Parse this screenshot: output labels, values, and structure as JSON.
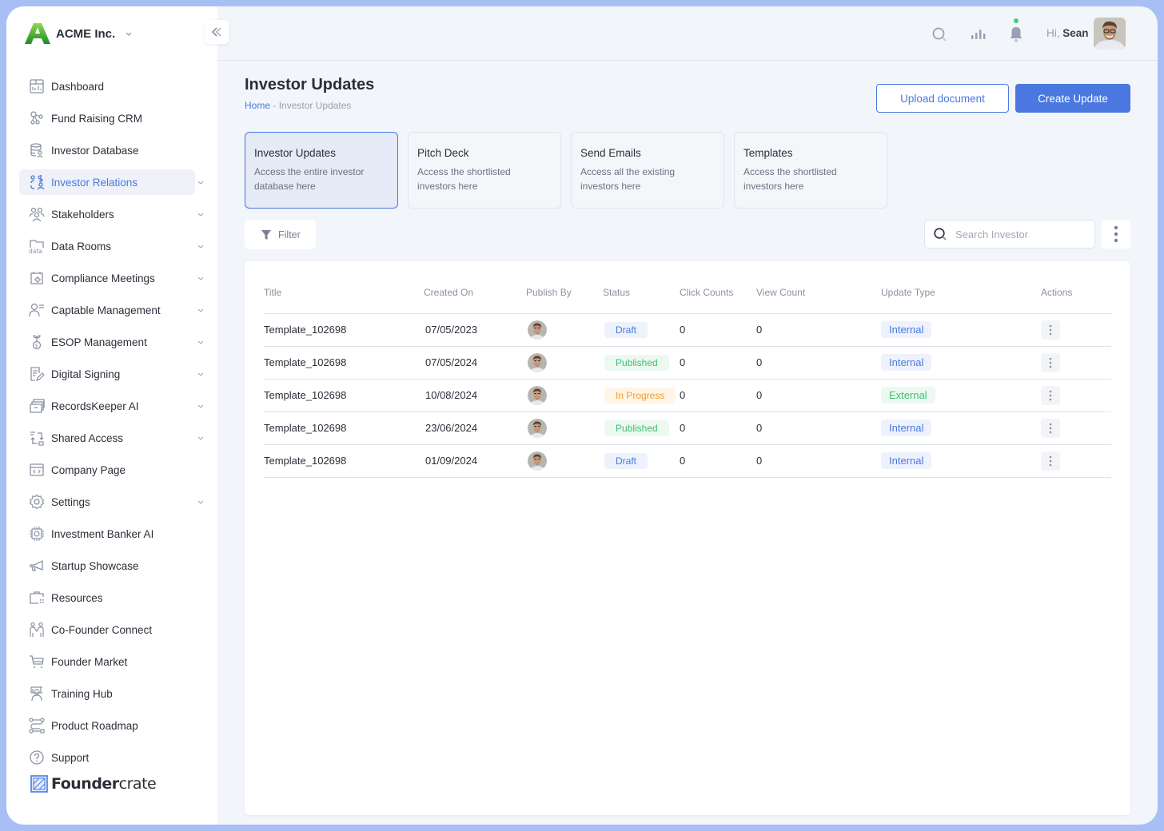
{
  "brand": {
    "name": "ACME Inc."
  },
  "sidebar": {
    "items": [
      {
        "label": "Dashboard",
        "icon": "dashboard-icon",
        "has_children": false,
        "active": false
      },
      {
        "label": "Fund Raising CRM",
        "icon": "crm-icon",
        "has_children": false,
        "active": false
      },
      {
        "label": "Investor Database",
        "icon": "database-user-icon",
        "has_children": false,
        "active": false
      },
      {
        "label": "Investor Relations",
        "icon": "investor-relations-icon",
        "has_children": true,
        "active": true
      },
      {
        "label": "Stakeholders",
        "icon": "users-icon",
        "has_children": true,
        "active": false
      },
      {
        "label": "Data Rooms",
        "icon": "data-folder-icon",
        "has_children": true,
        "active": false
      },
      {
        "label": "Compliance Meetings",
        "icon": "calendar-gear-icon",
        "has_children": true,
        "active": false
      },
      {
        "label": "Captable Management",
        "icon": "user-list-icon",
        "has_children": true,
        "active": false
      },
      {
        "label": "ESOP Management",
        "icon": "plant-coin-icon",
        "has_children": true,
        "active": false
      },
      {
        "label": "Digital Signing",
        "icon": "document-sign-icon",
        "has_children": true,
        "active": false
      },
      {
        "label": "RecordsKeeper AI",
        "icon": "archive-icon",
        "has_children": true,
        "active": false
      },
      {
        "label": "Shared Access",
        "icon": "share-access-icon",
        "has_children": true,
        "active": false
      },
      {
        "label": "Company Page",
        "icon": "browser-code-icon",
        "has_children": false,
        "active": false
      },
      {
        "label": "Settings",
        "icon": "gear-icon",
        "has_children": true,
        "active": false
      },
      {
        "label": "Investment Banker AI",
        "icon": "chip-icon",
        "has_children": false,
        "active": false
      },
      {
        "label": "Startup Showcase",
        "icon": "megaphone-icon",
        "has_children": false,
        "active": false
      },
      {
        "label": "Resources",
        "icon": "briefcase-icon",
        "has_children": false,
        "active": false
      },
      {
        "label": "Co-Founder Connect",
        "icon": "two-people-icon",
        "has_children": false,
        "active": false
      },
      {
        "label": "Founder Market",
        "icon": "cart-icon",
        "has_children": false,
        "active": false
      },
      {
        "label": "Training Hub",
        "icon": "trainer-icon",
        "has_children": false,
        "active": false
      },
      {
        "label": "Product Roadmap",
        "icon": "roadmap-icon",
        "has_children": false,
        "active": false
      },
      {
        "label": "Support",
        "icon": "help-circle-icon",
        "has_children": false,
        "active": false
      }
    ],
    "footer_logo": {
      "bold": "Founder",
      "light": "crate"
    }
  },
  "topbar": {
    "greeting_prefix": "Hi,",
    "user_name": "Sean",
    "notification_dot_color": "#3fcf7a"
  },
  "page": {
    "title": "Investor Updates",
    "breadcrumb": {
      "home": "Home",
      "separator": "-",
      "current": "Investor Updates"
    },
    "upload_button": "Upload document",
    "create_button": "Create Update"
  },
  "tabs": [
    {
      "title": "Investor Updates",
      "desc": "Access the entire investor database here",
      "active": true
    },
    {
      "title": "Pitch Deck",
      "desc": "Access the shortlisted investors here",
      "active": false
    },
    {
      "title": "Send Emails",
      "desc": "Access all the existing investors here",
      "active": false
    },
    {
      "title": "Templates",
      "desc": "Access the shortlisted investors here",
      "active": false
    }
  ],
  "toolbar": {
    "filter_label": "Filter",
    "search_placeholder": "Search Investor",
    "search_value": ""
  },
  "table": {
    "columns": [
      "Title",
      "Created On",
      "Publish By",
      "Status",
      "Click Counts",
      "View Count",
      "Update Type",
      "Actions"
    ],
    "rows": [
      {
        "title": "Template_102698",
        "created_on": "07/05/2023",
        "status": "Draft",
        "status_key": "Draft",
        "clicks": "0",
        "views": "0",
        "type": "Internal"
      },
      {
        "title": "Template_102698",
        "created_on": "07/05/2024",
        "status": "Published",
        "status_key": "Published",
        "clicks": "0",
        "views": "0",
        "type": "Internal"
      },
      {
        "title": "Template_102698",
        "created_on": "10/08/2024",
        "status": "In Progress",
        "status_key": "InProgress",
        "clicks": "0",
        "views": "0",
        "type": "External"
      },
      {
        "title": "Template_102698",
        "created_on": "23/06/2024",
        "status": "Published",
        "status_key": "Published",
        "clicks": "0",
        "views": "0",
        "type": "Internal"
      },
      {
        "title": "Template_102698",
        "created_on": "01/09/2024",
        "status": "Draft",
        "status_key": "Draft",
        "clicks": "0",
        "views": "0",
        "type": "Internal"
      }
    ]
  },
  "colors": {
    "accent": "#4a78e0",
    "draft": "#4a78e0",
    "published": "#3fbf72",
    "in_progress": "#f0a020",
    "frame": "#a7bff5"
  }
}
